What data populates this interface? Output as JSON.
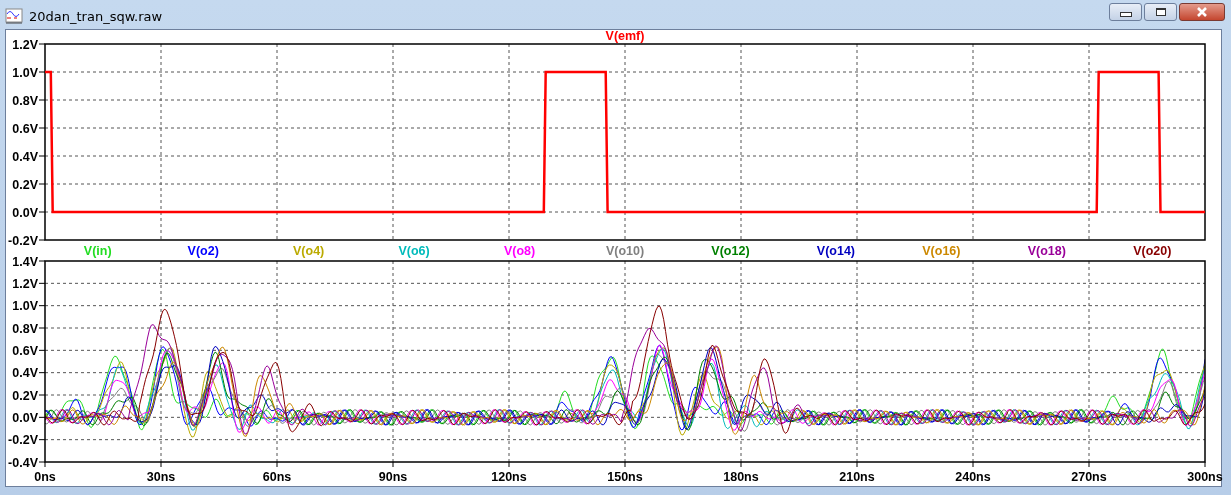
{
  "window": {
    "title": "20dan_tran_sqw.raw"
  },
  "upper_pane": {
    "trace": {
      "label": "V(emf)",
      "color": "#ff0000"
    },
    "y_labels": [
      "1.2V",
      "1.0V",
      "0.8V",
      "0.6V",
      "0.4V",
      "0.2V",
      "0.0V",
      "-0.2V"
    ]
  },
  "lower_pane": {
    "legend": [
      {
        "label": "V(in)",
        "color": "#22dd22"
      },
      {
        "label": "V(o2)",
        "color": "#0000ff"
      },
      {
        "label": "V(o4)",
        "color": "#bbaa00"
      },
      {
        "label": "V(o6)",
        "color": "#00bbbb"
      },
      {
        "label": "V(o8)",
        "color": "#ff00ff"
      },
      {
        "label": "V(o10)",
        "color": "#808080"
      },
      {
        "label": "V(o12)",
        "color": "#008000"
      },
      {
        "label": "V(o14)",
        "color": "#0000c0"
      },
      {
        "label": "V(o16)",
        "color": "#cc8800"
      },
      {
        "label": "V(o18)",
        "color": "#990099"
      },
      {
        "label": "V(o20)",
        "color": "#880000"
      }
    ],
    "y_labels": [
      "1.4V",
      "1.2V",
      "1.0V",
      "0.8V",
      "0.6V",
      "0.4V",
      "0.2V",
      "0.0V",
      "-0.2V",
      "-0.4V"
    ],
    "x_labels": [
      "0ns",
      "30ns",
      "60ns",
      "90ns",
      "120ns",
      "150ns",
      "180ns",
      "210ns",
      "240ns",
      "270ns",
      "300ns"
    ]
  }
}
